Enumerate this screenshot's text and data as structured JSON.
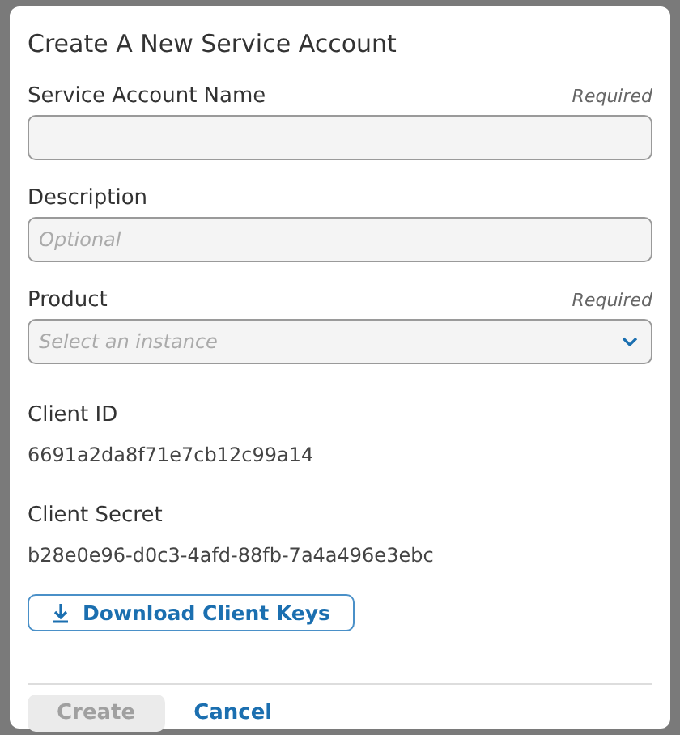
{
  "dialog": {
    "title": "Create A New Service Account",
    "fields": [
      {
        "kind": "text",
        "label": "Service Account Name",
        "required_note": "Required"
      },
      {
        "kind": "text",
        "label": "Description",
        "placeholder": "Optional"
      },
      {
        "kind": "select",
        "label": "Product",
        "required_note": "Required",
        "placeholder": "Select an instance"
      }
    ],
    "info": [
      {
        "label": "Client ID",
        "value": "6691a2da8f71e7cb12c99a14"
      },
      {
        "label": "Client Secret",
        "value": "b28e0e96-d0c3-4afd-88fb-7a4a496e3ebc"
      }
    ],
    "download_button": "Download Client Keys",
    "buttons": [
      {
        "label": "Create",
        "kind": "primary",
        "disabled": true
      },
      {
        "label": "Cancel",
        "kind": "link",
        "disabled": false
      }
    ]
  }
}
